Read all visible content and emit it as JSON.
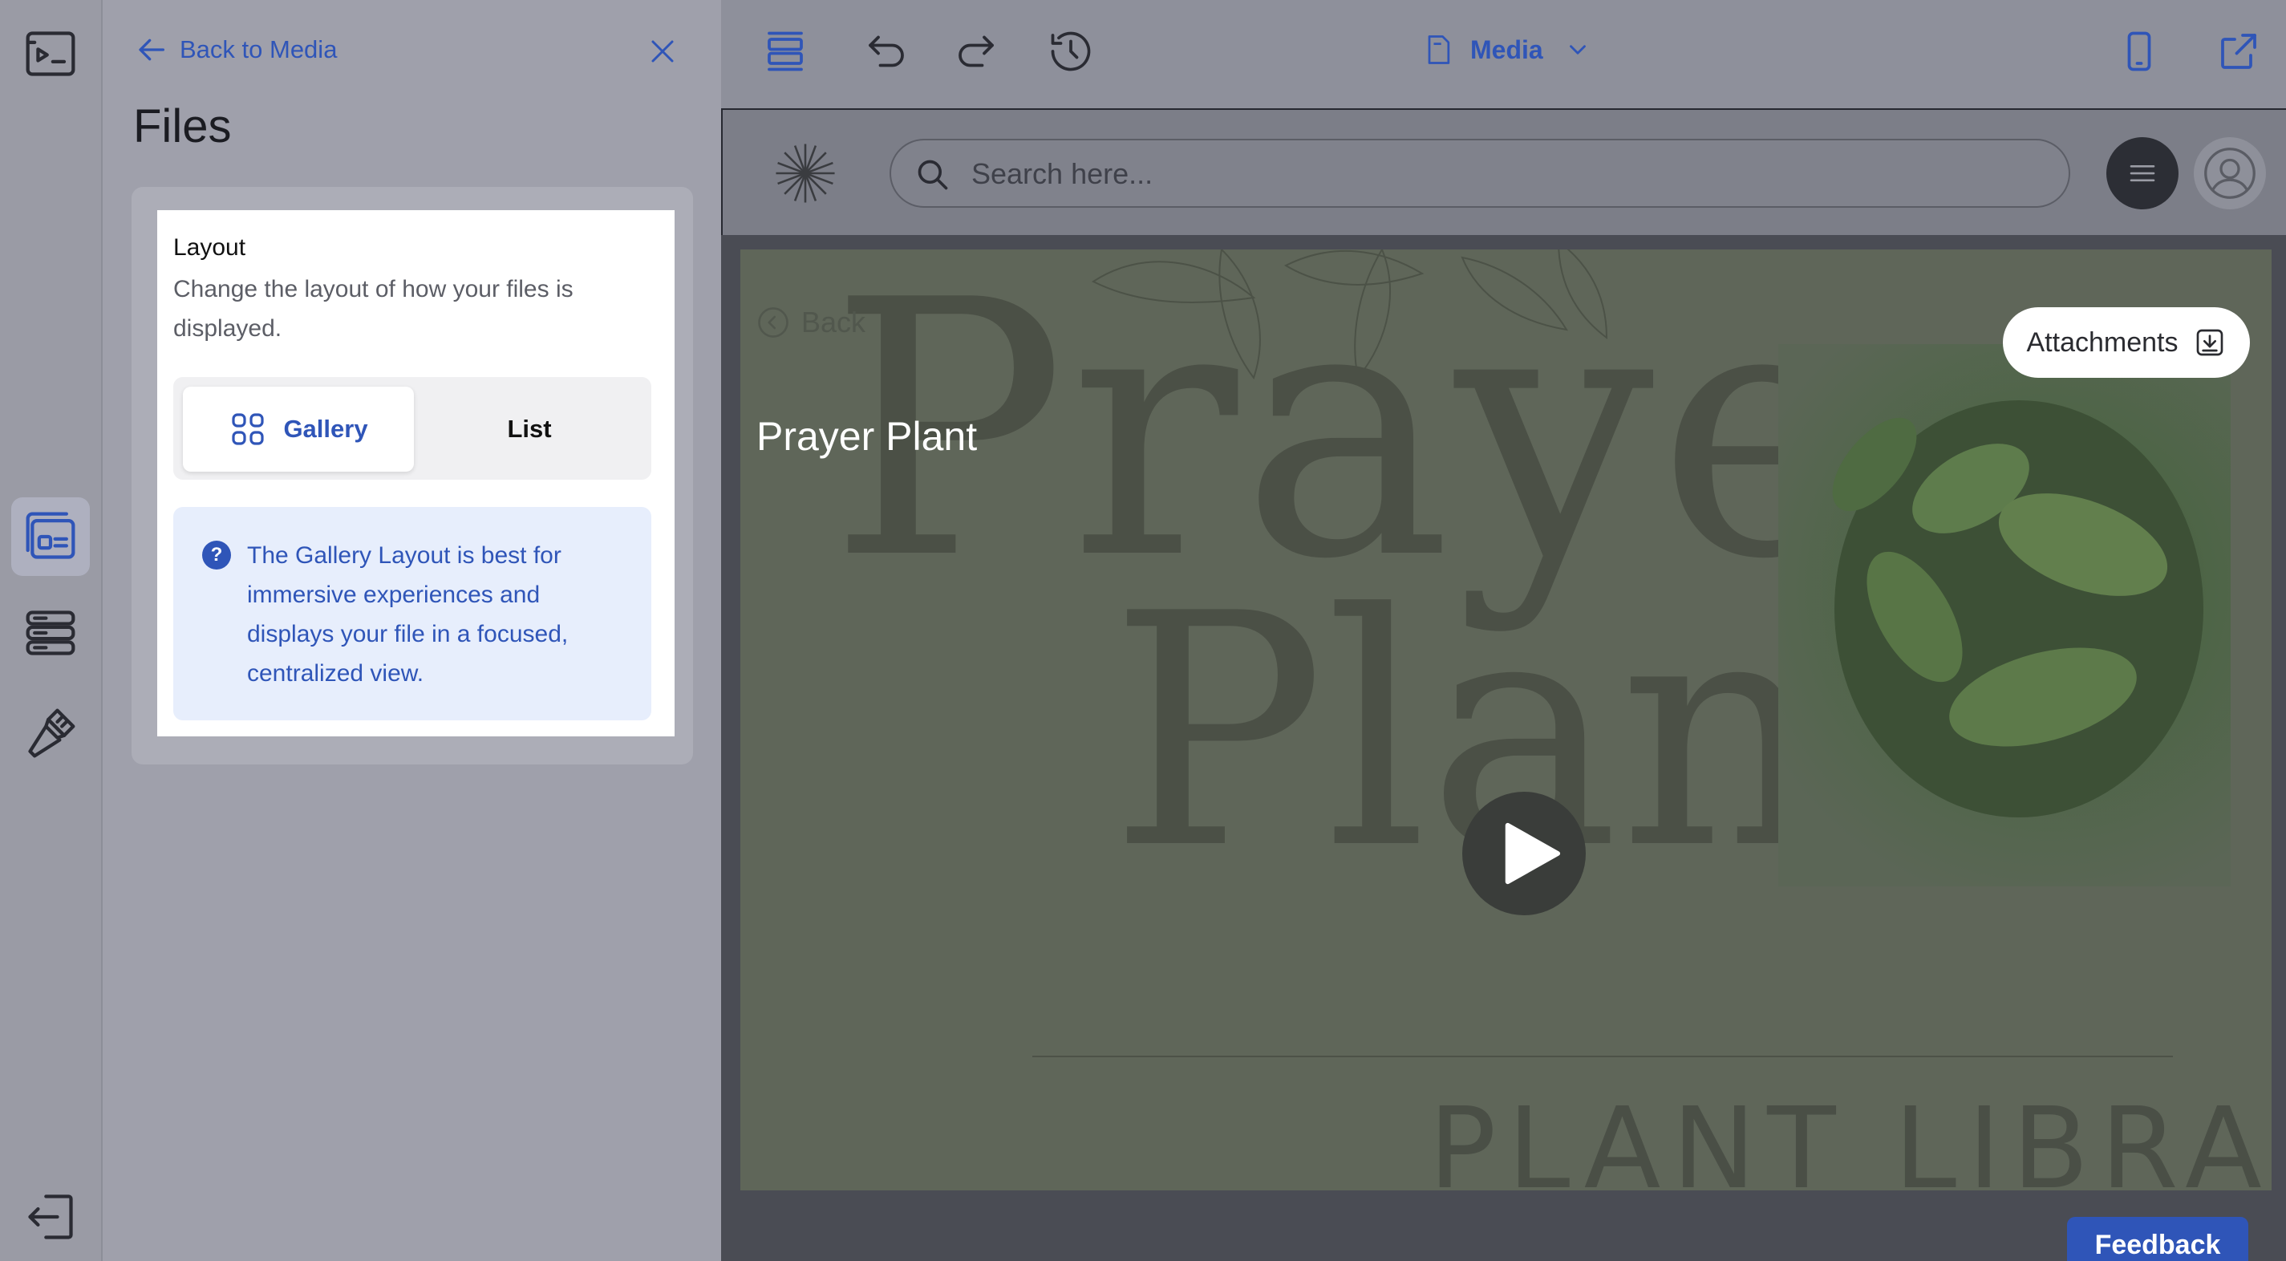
{
  "panel": {
    "back_label": "Back to Media",
    "title": "Files",
    "layout_label": "Layout",
    "layout_description": "Change the layout of how your files is displayed.",
    "options": [
      {
        "label": "Gallery",
        "selected": true
      },
      {
        "label": "List",
        "selected": false
      }
    ],
    "info_text": "The Gallery Layout is best for immersive experiences and displays your file in a focused, centralized view."
  },
  "toolbar": {
    "page_selector": "Media"
  },
  "site": {
    "search_placeholder": "Search here..."
  },
  "preview": {
    "back_label": "Back",
    "item_title": "Prayer Plant",
    "attachments_label": "Attachments",
    "bg_word_1": "Prayer",
    "bg_word_2": "Plant",
    "bg_library": "PLANT LIBRARY"
  },
  "feedback_label": "Feedback",
  "colors": {
    "accent": "#2f55b8",
    "panel_bg": "#9fa0ab",
    "info_bg": "#e7eefc"
  },
  "icons": {
    "rail": [
      "preview-icon",
      "gallery-layout-icon",
      "list-layout-icon",
      "design-brush-icon",
      "exit-icon"
    ],
    "toolbar": [
      "sections-icon",
      "undo-icon",
      "redo-icon",
      "history-icon",
      "page-icon",
      "chevron-down-icon",
      "mobile-icon",
      "external-link-icon"
    ]
  }
}
